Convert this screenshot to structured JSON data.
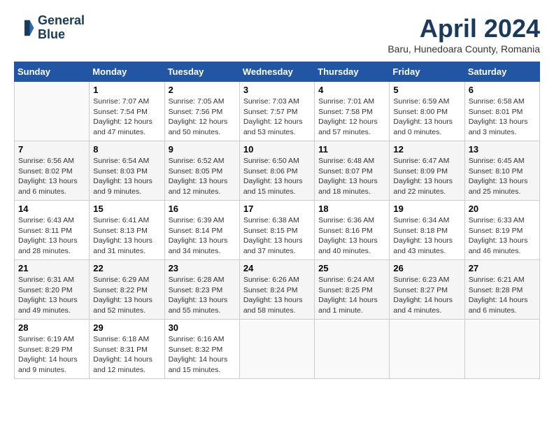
{
  "header": {
    "logo_line1": "General",
    "logo_line2": "Blue",
    "month": "April 2024",
    "location": "Baru, Hunedoara County, Romania"
  },
  "days_of_week": [
    "Sunday",
    "Monday",
    "Tuesday",
    "Wednesday",
    "Thursday",
    "Friday",
    "Saturday"
  ],
  "weeks": [
    [
      {
        "day": "",
        "info": ""
      },
      {
        "day": "1",
        "info": "Sunrise: 7:07 AM\nSunset: 7:54 PM\nDaylight: 12 hours\nand 47 minutes."
      },
      {
        "day": "2",
        "info": "Sunrise: 7:05 AM\nSunset: 7:56 PM\nDaylight: 12 hours\nand 50 minutes."
      },
      {
        "day": "3",
        "info": "Sunrise: 7:03 AM\nSunset: 7:57 PM\nDaylight: 12 hours\nand 53 minutes."
      },
      {
        "day": "4",
        "info": "Sunrise: 7:01 AM\nSunset: 7:58 PM\nDaylight: 12 hours\nand 57 minutes."
      },
      {
        "day": "5",
        "info": "Sunrise: 6:59 AM\nSunset: 8:00 PM\nDaylight: 13 hours\nand 0 minutes."
      },
      {
        "day": "6",
        "info": "Sunrise: 6:58 AM\nSunset: 8:01 PM\nDaylight: 13 hours\nand 3 minutes."
      }
    ],
    [
      {
        "day": "7",
        "info": "Sunrise: 6:56 AM\nSunset: 8:02 PM\nDaylight: 13 hours\nand 6 minutes."
      },
      {
        "day": "8",
        "info": "Sunrise: 6:54 AM\nSunset: 8:03 PM\nDaylight: 13 hours\nand 9 minutes."
      },
      {
        "day": "9",
        "info": "Sunrise: 6:52 AM\nSunset: 8:05 PM\nDaylight: 13 hours\nand 12 minutes."
      },
      {
        "day": "10",
        "info": "Sunrise: 6:50 AM\nSunset: 8:06 PM\nDaylight: 13 hours\nand 15 minutes."
      },
      {
        "day": "11",
        "info": "Sunrise: 6:48 AM\nSunset: 8:07 PM\nDaylight: 13 hours\nand 18 minutes."
      },
      {
        "day": "12",
        "info": "Sunrise: 6:47 AM\nSunset: 8:09 PM\nDaylight: 13 hours\nand 22 minutes."
      },
      {
        "day": "13",
        "info": "Sunrise: 6:45 AM\nSunset: 8:10 PM\nDaylight: 13 hours\nand 25 minutes."
      }
    ],
    [
      {
        "day": "14",
        "info": "Sunrise: 6:43 AM\nSunset: 8:11 PM\nDaylight: 13 hours\nand 28 minutes."
      },
      {
        "day": "15",
        "info": "Sunrise: 6:41 AM\nSunset: 8:13 PM\nDaylight: 13 hours\nand 31 minutes."
      },
      {
        "day": "16",
        "info": "Sunrise: 6:39 AM\nSunset: 8:14 PM\nDaylight: 13 hours\nand 34 minutes."
      },
      {
        "day": "17",
        "info": "Sunrise: 6:38 AM\nSunset: 8:15 PM\nDaylight: 13 hours\nand 37 minutes."
      },
      {
        "day": "18",
        "info": "Sunrise: 6:36 AM\nSunset: 8:16 PM\nDaylight: 13 hours\nand 40 minutes."
      },
      {
        "day": "19",
        "info": "Sunrise: 6:34 AM\nSunset: 8:18 PM\nDaylight: 13 hours\nand 43 minutes."
      },
      {
        "day": "20",
        "info": "Sunrise: 6:33 AM\nSunset: 8:19 PM\nDaylight: 13 hours\nand 46 minutes."
      }
    ],
    [
      {
        "day": "21",
        "info": "Sunrise: 6:31 AM\nSunset: 8:20 PM\nDaylight: 13 hours\nand 49 minutes."
      },
      {
        "day": "22",
        "info": "Sunrise: 6:29 AM\nSunset: 8:22 PM\nDaylight: 13 hours\nand 52 minutes."
      },
      {
        "day": "23",
        "info": "Sunrise: 6:28 AM\nSunset: 8:23 PM\nDaylight: 13 hours\nand 55 minutes."
      },
      {
        "day": "24",
        "info": "Sunrise: 6:26 AM\nSunset: 8:24 PM\nDaylight: 13 hours\nand 58 minutes."
      },
      {
        "day": "25",
        "info": "Sunrise: 6:24 AM\nSunset: 8:25 PM\nDaylight: 14 hours\nand 1 minute."
      },
      {
        "day": "26",
        "info": "Sunrise: 6:23 AM\nSunset: 8:27 PM\nDaylight: 14 hours\nand 4 minutes."
      },
      {
        "day": "27",
        "info": "Sunrise: 6:21 AM\nSunset: 8:28 PM\nDaylight: 14 hours\nand 6 minutes."
      }
    ],
    [
      {
        "day": "28",
        "info": "Sunrise: 6:19 AM\nSunset: 8:29 PM\nDaylight: 14 hours\nand 9 minutes."
      },
      {
        "day": "29",
        "info": "Sunrise: 6:18 AM\nSunset: 8:31 PM\nDaylight: 14 hours\nand 12 minutes."
      },
      {
        "day": "30",
        "info": "Sunrise: 6:16 AM\nSunset: 8:32 PM\nDaylight: 14 hours\nand 15 minutes."
      },
      {
        "day": "",
        "info": ""
      },
      {
        "day": "",
        "info": ""
      },
      {
        "day": "",
        "info": ""
      },
      {
        "day": "",
        "info": ""
      }
    ]
  ]
}
